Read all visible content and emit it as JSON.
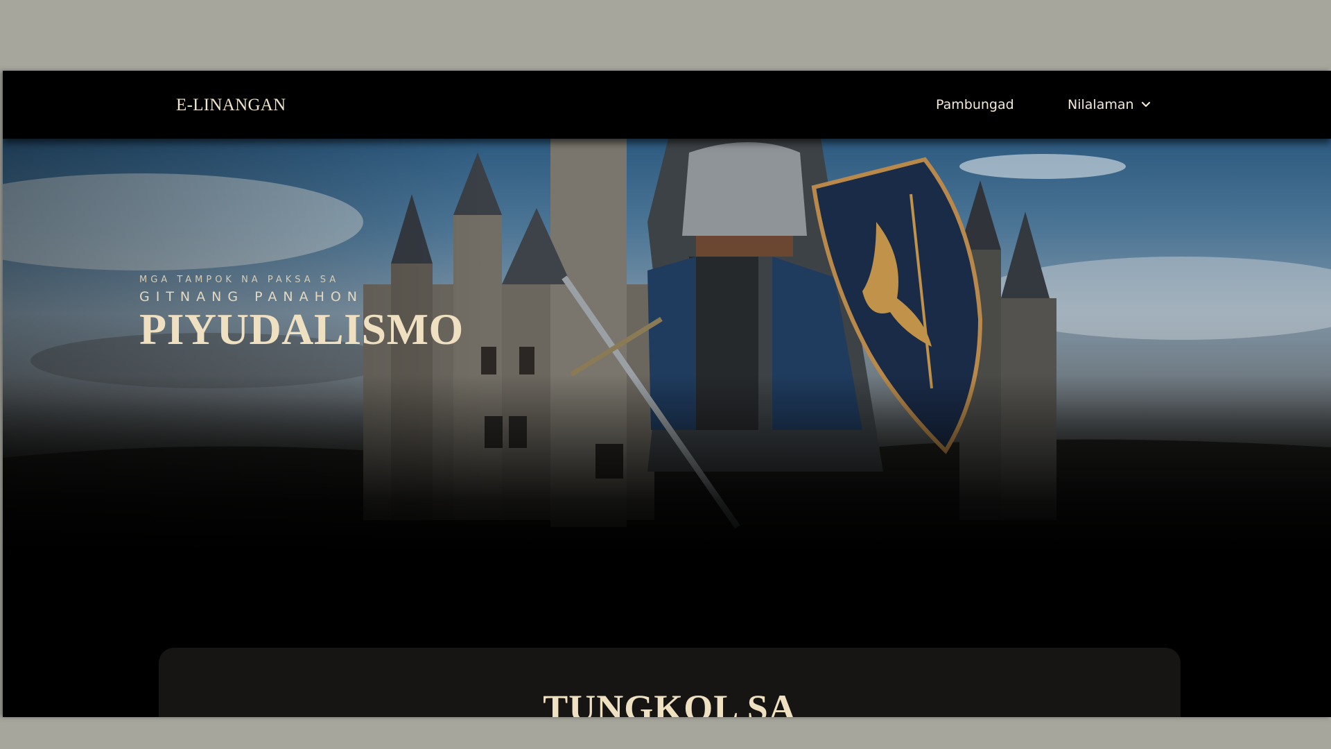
{
  "navbar": {
    "brand": "E-LINANGAN",
    "links": [
      {
        "label": "Pambungad"
      },
      {
        "label": "Nilalaman",
        "icon": "chevron-down-icon"
      }
    ]
  },
  "hero": {
    "eyebrow": "MGA TAMPOK NA PAKSA SA",
    "kicker": "GITNANG PANAHON",
    "title": "PIYUDALISMO",
    "image": "knight-castle-illustration"
  },
  "about": {
    "title": "TUNGKOL SA"
  },
  "colors": {
    "background": "#a6a69d",
    "page": "#000000",
    "accent_text": "#efe0c2",
    "card": "#161513"
  }
}
